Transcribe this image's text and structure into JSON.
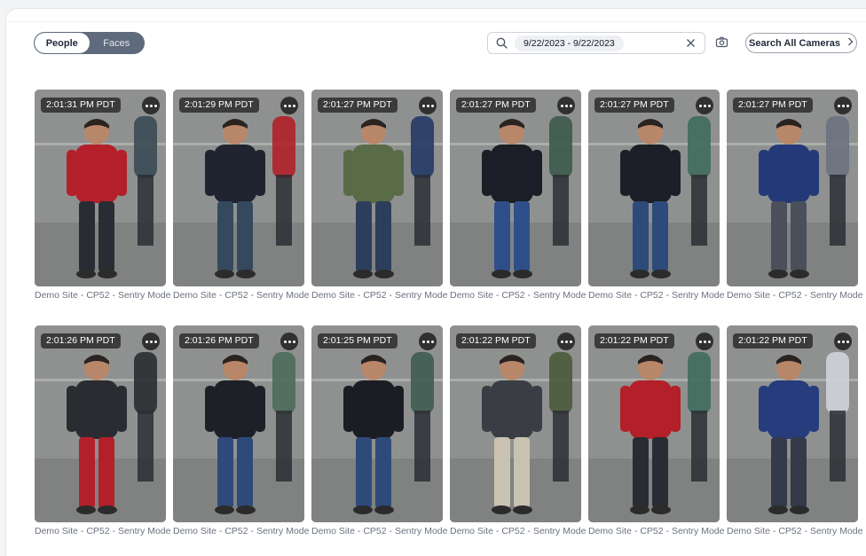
{
  "toggle": {
    "people_label": "People",
    "faces_label": "Faces",
    "active": "People"
  },
  "search": {
    "date_range": "9/22/2023 - 9/22/2023"
  },
  "search_all_label": "Search All Cameras",
  "results": [
    {
      "time": "2:01:31 PM PDT",
      "camera": "Demo Site - CP52 - Sentry Mode",
      "shirt": "#b3202a",
      "pants": "#2a2c33",
      "extra": "#3b4a55"
    },
    {
      "time": "2:01:29 PM PDT",
      "camera": "Demo Site - CP52 - Sentry Mode",
      "shirt": "#1f2430",
      "pants": "#34495e",
      "extra": "#b3202a"
    },
    {
      "time": "2:01:27 PM PDT",
      "camera": "Demo Site - CP52 - Sentry Mode",
      "shirt": "#5a6b47",
      "pants": "#2c3e5c",
      "extra": "#243a66"
    },
    {
      "time": "2:01:27 PM PDT",
      "camera": "Demo Site - CP52 - Sentry Mode",
      "shirt": "#1b1e26",
      "pants": "#2f4f8a",
      "extra": "#3d5a4c"
    },
    {
      "time": "2:01:27 PM PDT",
      "camera": "Demo Site - CP52 - Sentry Mode",
      "shirt": "#1c1f27",
      "pants": "#2e4a7a",
      "extra": "#3f6b5d"
    },
    {
      "time": "2:01:27 PM PDT",
      "camera": "Demo Site - CP52 - Sentry Mode",
      "shirt": "#243a78",
      "pants": "#4a4f5a",
      "extra": "#6b7280"
    },
    {
      "time": "2:01:26 PM PDT",
      "camera": "Demo Site - CP52 - Sentry Mode",
      "shirt": "#2a2c31",
      "pants": "#b3202a",
      "extra": "#2a2c31"
    },
    {
      "time": "2:01:26 PM PDT",
      "camera": "Demo Site - CP52 - Sentry Mode",
      "shirt": "#1d2027",
      "pants": "#2e4a7a",
      "extra": "#4b6b5a"
    },
    {
      "time": "2:01:25 PM PDT",
      "camera": "Demo Site - CP52 - Sentry Mode",
      "shirt": "#1b1d24",
      "pants": "#2e4a7a",
      "extra": "#3e5c52"
    },
    {
      "time": "2:01:22 PM PDT",
      "camera": "Demo Site - CP52 - Sentry Mode",
      "shirt": "#3a3e44",
      "pants": "#c9c2b2",
      "extra": "#4a5a3a"
    },
    {
      "time": "2:01:22 PM PDT",
      "camera": "Demo Site - CP52 - Sentry Mode",
      "shirt": "#b3202a",
      "pants": "#2a2c33",
      "extra": "#3f6b5d"
    },
    {
      "time": "2:01:22 PM PDT",
      "camera": "Demo Site - CP52 - Sentry Mode",
      "shirt": "#263c7c",
      "pants": "#343a4a",
      "extra": "#cfd4da"
    }
  ]
}
